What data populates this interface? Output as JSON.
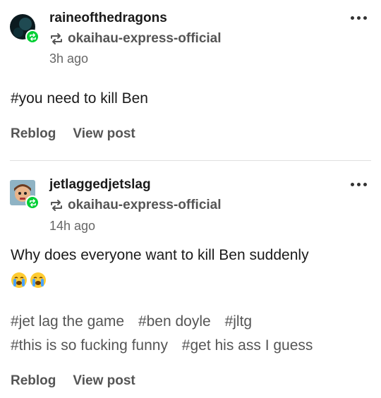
{
  "posts": [
    {
      "username": "raineofthedragons",
      "reblogged_from": "okaihau-express-official",
      "timestamp": "3h ago",
      "body": "#you need to kill Ben",
      "actions": {
        "reblog": "Reblog",
        "view_post": "View post"
      }
    },
    {
      "username": "jetlaggedjetslag",
      "reblogged_from": "okaihau-express-official",
      "timestamp": "14h ago",
      "body": "Why does everyone want to kill Ben suddenly",
      "emoji": [
        "loudly-crying-face",
        "loudly-crying-face"
      ],
      "tags": [
        "#jet lag the game",
        "#ben doyle",
        "#jltg",
        "#this is so fucking funny",
        "#get his ass I guess"
      ],
      "actions": {
        "reblog": "Reblog",
        "view_post": "View post"
      }
    }
  ],
  "colors": {
    "reblog_badge": "#00cf35",
    "secondary_text": "#555555"
  }
}
